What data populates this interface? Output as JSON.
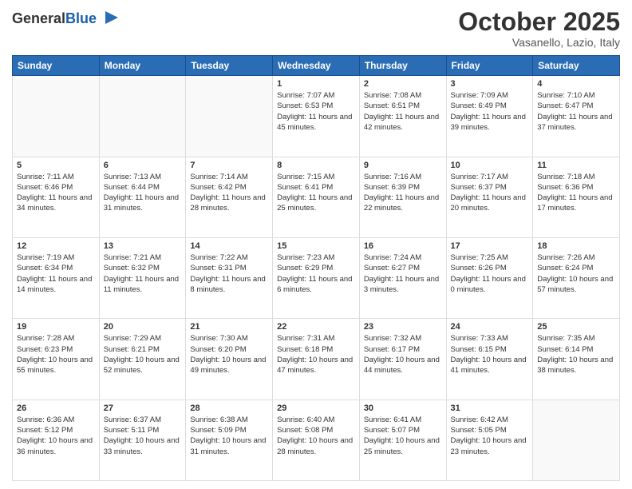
{
  "header": {
    "logo_general": "General",
    "logo_blue": "Blue",
    "month": "October 2025",
    "location": "Vasanello, Lazio, Italy"
  },
  "weekdays": [
    "Sunday",
    "Monday",
    "Tuesday",
    "Wednesday",
    "Thursday",
    "Friday",
    "Saturday"
  ],
  "weeks": [
    [
      {
        "day": "",
        "sunrise": "",
        "sunset": "",
        "daylight": ""
      },
      {
        "day": "",
        "sunrise": "",
        "sunset": "",
        "daylight": ""
      },
      {
        "day": "",
        "sunrise": "",
        "sunset": "",
        "daylight": ""
      },
      {
        "day": "1",
        "sunrise": "Sunrise: 7:07 AM",
        "sunset": "Sunset: 6:53 PM",
        "daylight": "Daylight: 11 hours and 45 minutes."
      },
      {
        "day": "2",
        "sunrise": "Sunrise: 7:08 AM",
        "sunset": "Sunset: 6:51 PM",
        "daylight": "Daylight: 11 hours and 42 minutes."
      },
      {
        "day": "3",
        "sunrise": "Sunrise: 7:09 AM",
        "sunset": "Sunset: 6:49 PM",
        "daylight": "Daylight: 11 hours and 39 minutes."
      },
      {
        "day": "4",
        "sunrise": "Sunrise: 7:10 AM",
        "sunset": "Sunset: 6:47 PM",
        "daylight": "Daylight: 11 hours and 37 minutes."
      }
    ],
    [
      {
        "day": "5",
        "sunrise": "Sunrise: 7:11 AM",
        "sunset": "Sunset: 6:46 PM",
        "daylight": "Daylight: 11 hours and 34 minutes."
      },
      {
        "day": "6",
        "sunrise": "Sunrise: 7:13 AM",
        "sunset": "Sunset: 6:44 PM",
        "daylight": "Daylight: 11 hours and 31 minutes."
      },
      {
        "day": "7",
        "sunrise": "Sunrise: 7:14 AM",
        "sunset": "Sunset: 6:42 PM",
        "daylight": "Daylight: 11 hours and 28 minutes."
      },
      {
        "day": "8",
        "sunrise": "Sunrise: 7:15 AM",
        "sunset": "Sunset: 6:41 PM",
        "daylight": "Daylight: 11 hours and 25 minutes."
      },
      {
        "day": "9",
        "sunrise": "Sunrise: 7:16 AM",
        "sunset": "Sunset: 6:39 PM",
        "daylight": "Daylight: 11 hours and 22 minutes."
      },
      {
        "day": "10",
        "sunrise": "Sunrise: 7:17 AM",
        "sunset": "Sunset: 6:37 PM",
        "daylight": "Daylight: 11 hours and 20 minutes."
      },
      {
        "day": "11",
        "sunrise": "Sunrise: 7:18 AM",
        "sunset": "Sunset: 6:36 PM",
        "daylight": "Daylight: 11 hours and 17 minutes."
      }
    ],
    [
      {
        "day": "12",
        "sunrise": "Sunrise: 7:19 AM",
        "sunset": "Sunset: 6:34 PM",
        "daylight": "Daylight: 11 hours and 14 minutes."
      },
      {
        "day": "13",
        "sunrise": "Sunrise: 7:21 AM",
        "sunset": "Sunset: 6:32 PM",
        "daylight": "Daylight: 11 hours and 11 minutes."
      },
      {
        "day": "14",
        "sunrise": "Sunrise: 7:22 AM",
        "sunset": "Sunset: 6:31 PM",
        "daylight": "Daylight: 11 hours and 8 minutes."
      },
      {
        "day": "15",
        "sunrise": "Sunrise: 7:23 AM",
        "sunset": "Sunset: 6:29 PM",
        "daylight": "Daylight: 11 hours and 6 minutes."
      },
      {
        "day": "16",
        "sunrise": "Sunrise: 7:24 AM",
        "sunset": "Sunset: 6:27 PM",
        "daylight": "Daylight: 11 hours and 3 minutes."
      },
      {
        "day": "17",
        "sunrise": "Sunrise: 7:25 AM",
        "sunset": "Sunset: 6:26 PM",
        "daylight": "Daylight: 11 hours and 0 minutes."
      },
      {
        "day": "18",
        "sunrise": "Sunrise: 7:26 AM",
        "sunset": "Sunset: 6:24 PM",
        "daylight": "Daylight: 10 hours and 57 minutes."
      }
    ],
    [
      {
        "day": "19",
        "sunrise": "Sunrise: 7:28 AM",
        "sunset": "Sunset: 6:23 PM",
        "daylight": "Daylight: 10 hours and 55 minutes."
      },
      {
        "day": "20",
        "sunrise": "Sunrise: 7:29 AM",
        "sunset": "Sunset: 6:21 PM",
        "daylight": "Daylight: 10 hours and 52 minutes."
      },
      {
        "day": "21",
        "sunrise": "Sunrise: 7:30 AM",
        "sunset": "Sunset: 6:20 PM",
        "daylight": "Daylight: 10 hours and 49 minutes."
      },
      {
        "day": "22",
        "sunrise": "Sunrise: 7:31 AM",
        "sunset": "Sunset: 6:18 PM",
        "daylight": "Daylight: 10 hours and 47 minutes."
      },
      {
        "day": "23",
        "sunrise": "Sunrise: 7:32 AM",
        "sunset": "Sunset: 6:17 PM",
        "daylight": "Daylight: 10 hours and 44 minutes."
      },
      {
        "day": "24",
        "sunrise": "Sunrise: 7:33 AM",
        "sunset": "Sunset: 6:15 PM",
        "daylight": "Daylight: 10 hours and 41 minutes."
      },
      {
        "day": "25",
        "sunrise": "Sunrise: 7:35 AM",
        "sunset": "Sunset: 6:14 PM",
        "daylight": "Daylight: 10 hours and 38 minutes."
      }
    ],
    [
      {
        "day": "26",
        "sunrise": "Sunrise: 6:36 AM",
        "sunset": "Sunset: 5:12 PM",
        "daylight": "Daylight: 10 hours and 36 minutes."
      },
      {
        "day": "27",
        "sunrise": "Sunrise: 6:37 AM",
        "sunset": "Sunset: 5:11 PM",
        "daylight": "Daylight: 10 hours and 33 minutes."
      },
      {
        "day": "28",
        "sunrise": "Sunrise: 6:38 AM",
        "sunset": "Sunset: 5:09 PM",
        "daylight": "Daylight: 10 hours and 31 minutes."
      },
      {
        "day": "29",
        "sunrise": "Sunrise: 6:40 AM",
        "sunset": "Sunset: 5:08 PM",
        "daylight": "Daylight: 10 hours and 28 minutes."
      },
      {
        "day": "30",
        "sunrise": "Sunrise: 6:41 AM",
        "sunset": "Sunset: 5:07 PM",
        "daylight": "Daylight: 10 hours and 25 minutes."
      },
      {
        "day": "31",
        "sunrise": "Sunrise: 6:42 AM",
        "sunset": "Sunset: 5:05 PM",
        "daylight": "Daylight: 10 hours and 23 minutes."
      },
      {
        "day": "",
        "sunrise": "",
        "sunset": "",
        "daylight": ""
      }
    ]
  ]
}
